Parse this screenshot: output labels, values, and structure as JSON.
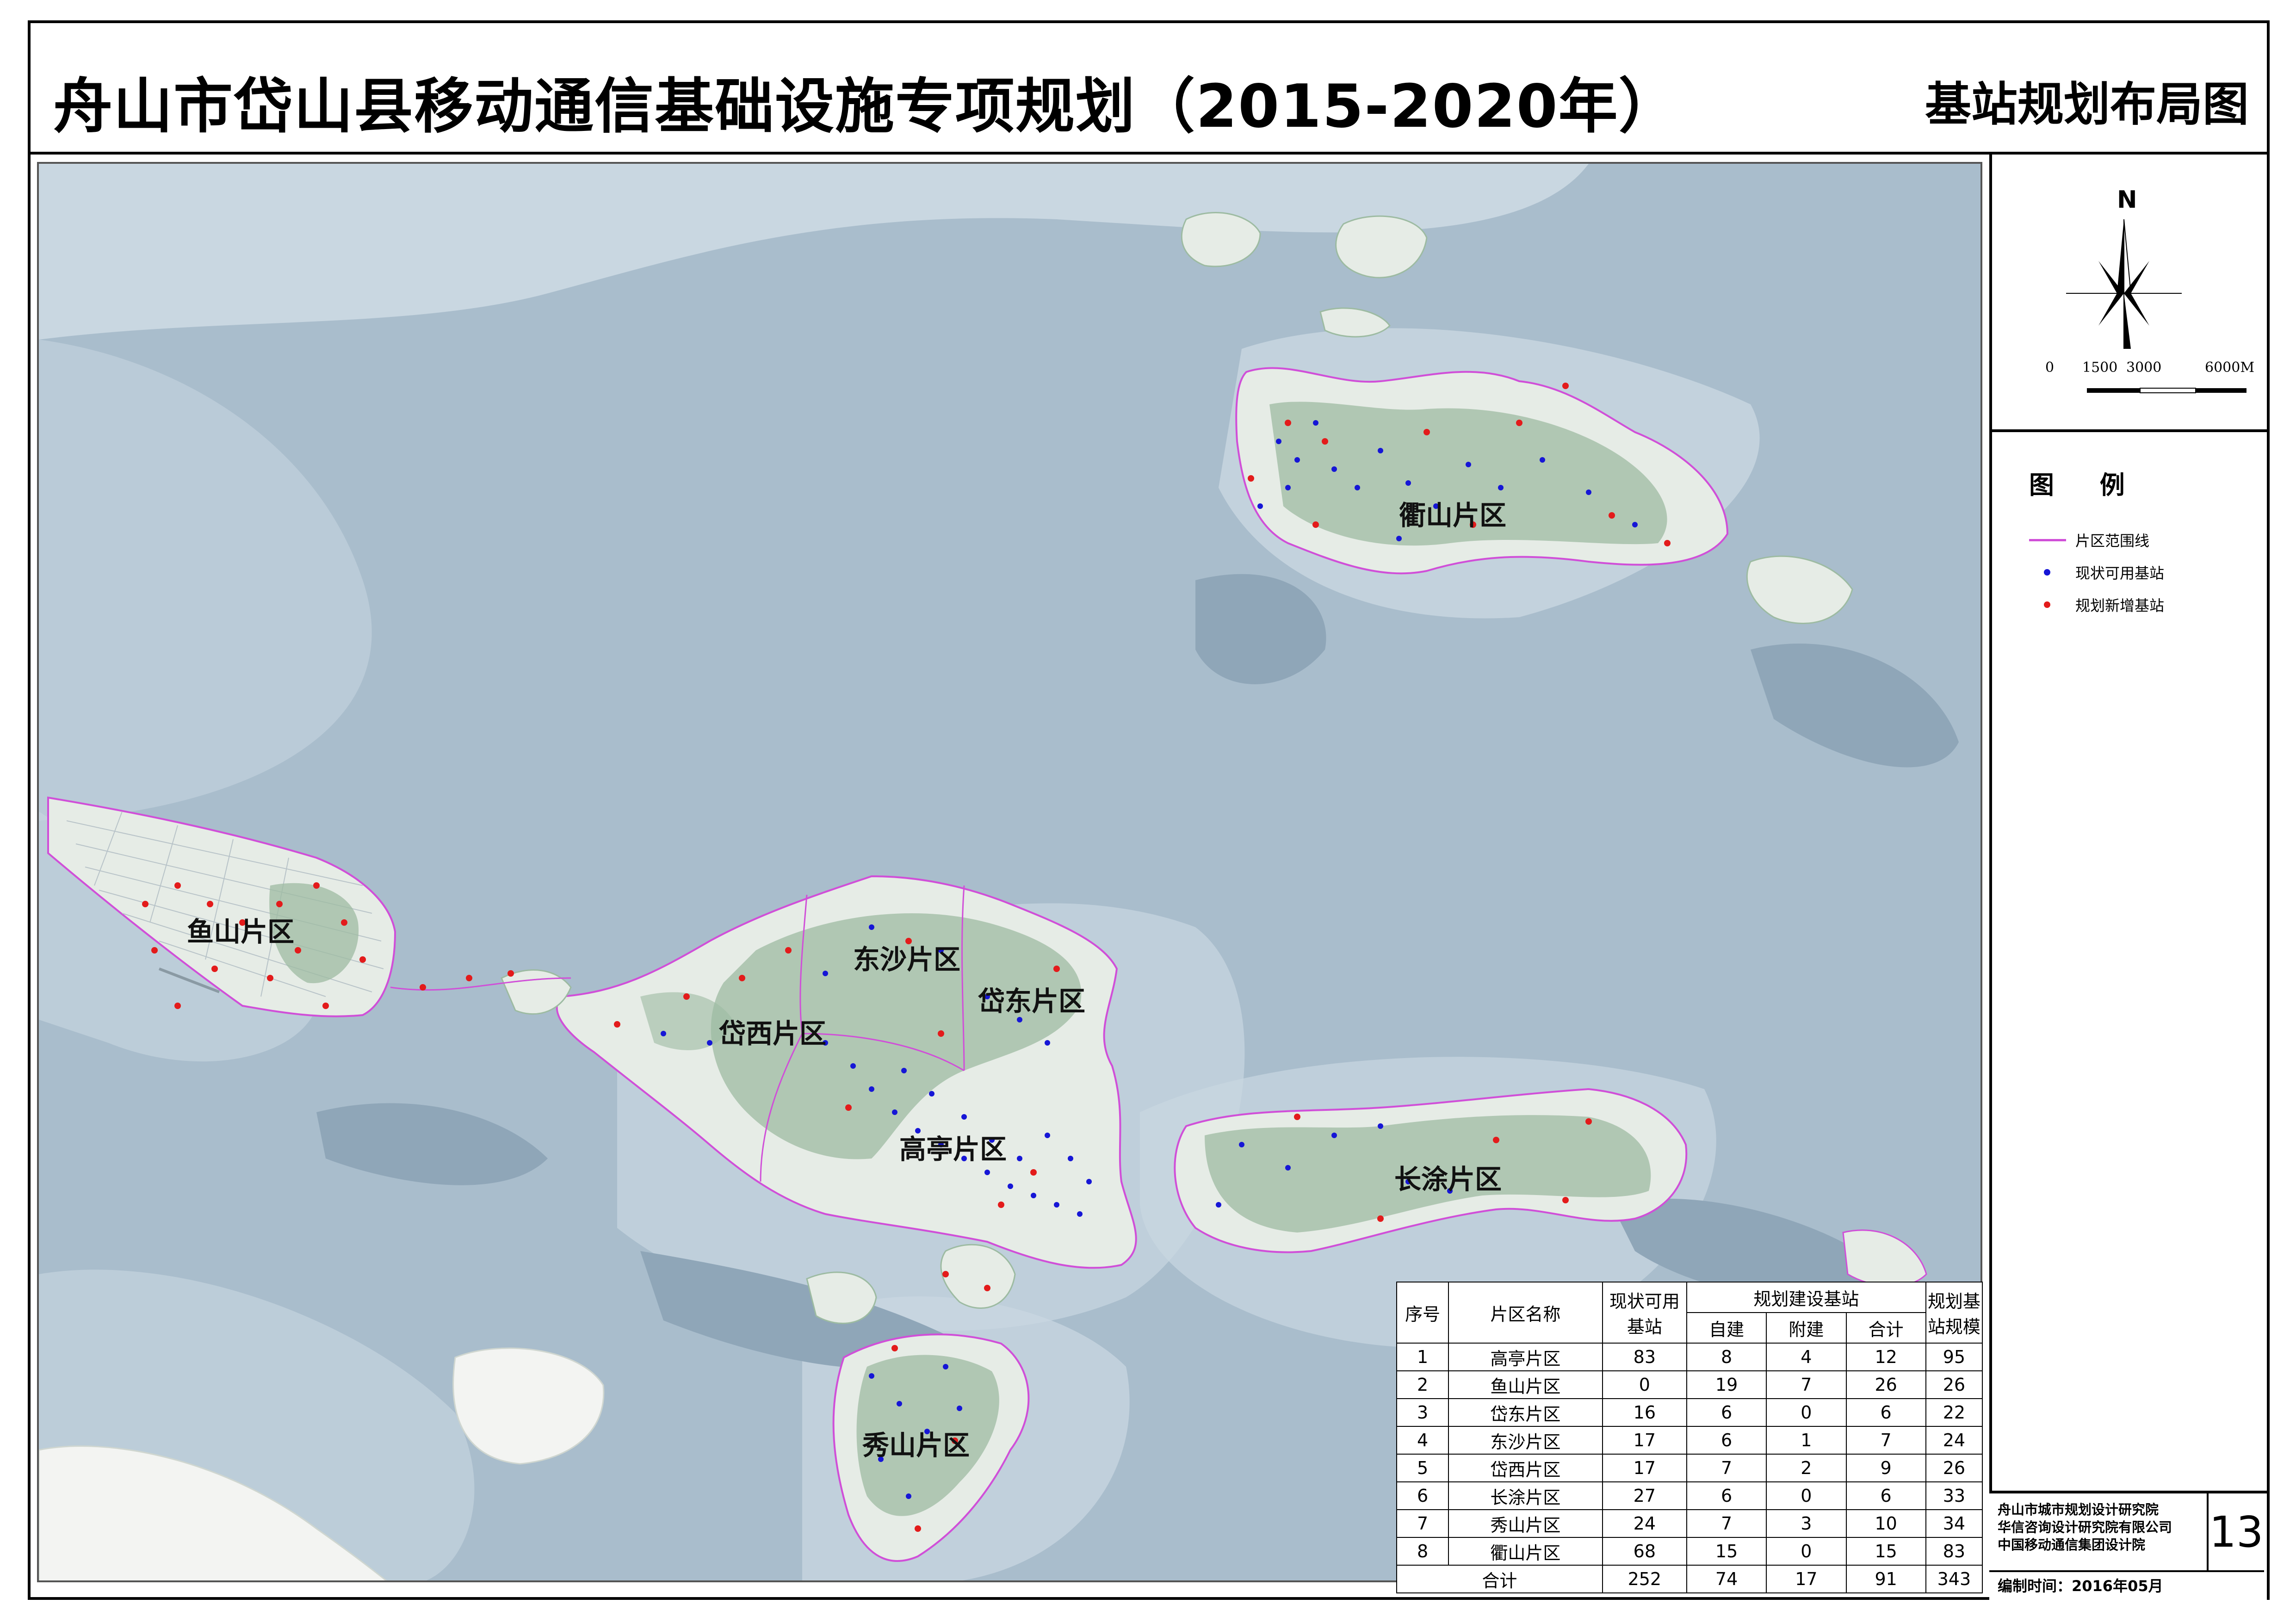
{
  "title": {
    "main": "舟山市岱山县移动通信基础设施专项规划（2015-2020年）",
    "sub": "基站规划布局图"
  },
  "compass": {
    "north_label": "N"
  },
  "scale_bar": {
    "labels": [
      "0",
      "1500",
      "3000",
      "6000M"
    ]
  },
  "legend": {
    "title": "图  例",
    "items": [
      {
        "label": "片区范围线",
        "symbol": "line",
        "color": "#d04fd8"
      },
      {
        "label": "现状可用基站",
        "symbol": "dot",
        "color": "#1616d6"
      },
      {
        "label": "规划新增基站",
        "symbol": "dot",
        "color": "#e31b1b"
      }
    ]
  },
  "map": {
    "region_labels": [
      "衢山片区",
      "鱼山片区",
      "东沙片区",
      "岱东片区",
      "岱西片区",
      "高亭片区",
      "长涂片区",
      "秀山片区"
    ],
    "colors": {
      "sea": "#a9bdcc",
      "shallow": "#c9d7e1",
      "deep": "#8fa6b8",
      "land": "#e6ece6",
      "hill": "#9dbba2",
      "boundary": "#d04fd8",
      "existing": "#1616d6",
      "planned": "#e31b1b"
    }
  },
  "table": {
    "headers": {
      "seq": "序号",
      "name": "片区名称",
      "existing": "现状可用基站",
      "planned_group": "规划建设基站",
      "self_built": "自建",
      "attached": "附建",
      "subtotal": "合计",
      "scale": "规划基站规模"
    },
    "rows": [
      {
        "seq": "1",
        "name": "高亭片区",
        "existing": "83",
        "self": "8",
        "attached": "4",
        "subtotal": "12",
        "scale": "95"
      },
      {
        "seq": "2",
        "name": "鱼山片区",
        "existing": "0",
        "self": "19",
        "attached": "7",
        "subtotal": "26",
        "scale": "26"
      },
      {
        "seq": "3",
        "name": "岱东片区",
        "existing": "16",
        "self": "6",
        "attached": "0",
        "subtotal": "6",
        "scale": "22"
      },
      {
        "seq": "4",
        "name": "东沙片区",
        "existing": "17",
        "self": "6",
        "attached": "1",
        "subtotal": "7",
        "scale": "24"
      },
      {
        "seq": "5",
        "name": "岱西片区",
        "existing": "17",
        "self": "7",
        "attached": "2",
        "subtotal": "9",
        "scale": "26"
      },
      {
        "seq": "6",
        "name": "长涂片区",
        "existing": "27",
        "self": "6",
        "attached": "0",
        "subtotal": "6",
        "scale": "33"
      },
      {
        "seq": "7",
        "name": "秀山片区",
        "existing": "24",
        "self": "7",
        "attached": "3",
        "subtotal": "10",
        "scale": "34"
      },
      {
        "seq": "8",
        "name": "衢山片区",
        "existing": "68",
        "self": "15",
        "attached": "0",
        "subtotal": "15",
        "scale": "83"
      }
    ],
    "total": {
      "label": "合计",
      "existing": "252",
      "self": "74",
      "attached": "17",
      "subtotal": "91",
      "scale": "343"
    }
  },
  "credits": {
    "lines": [
      "舟山市城市规划设计研究院",
      "华信咨询设计研究院有限公司",
      "中国移动通信集团设计院"
    ],
    "sheet_number": "13",
    "date": "编制时间：2016年05月"
  }
}
